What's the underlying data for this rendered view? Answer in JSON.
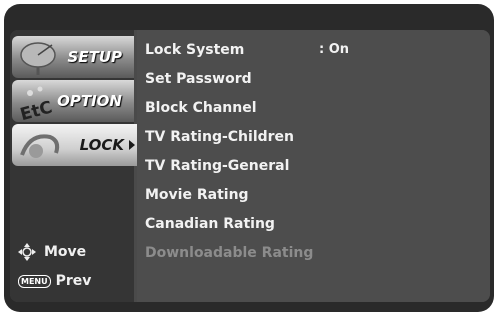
{
  "sidebar": {
    "tabs": [
      {
        "label": "SETUP",
        "icon": "satellite-dish-icon",
        "active": false
      },
      {
        "label": "OPTION",
        "icon": "etc-icon",
        "active": false
      },
      {
        "label": "LOCK",
        "icon": "lock-icon",
        "active": true
      }
    ],
    "legend": [
      {
        "icon": "navigation-pad-icon",
        "label": "Move"
      },
      {
        "icon": "menu-button-icon",
        "badge": "MENU",
        "label": "Prev"
      }
    ]
  },
  "menu": {
    "items": [
      {
        "label": "Lock System",
        "value": ": On",
        "enabled": true
      },
      {
        "label": "Set Password",
        "enabled": true
      },
      {
        "label": "Block Channel",
        "enabled": true
      },
      {
        "label": "TV Rating-Children",
        "enabled": true
      },
      {
        "label": "TV Rating-General",
        "enabled": true
      },
      {
        "label": "Movie Rating",
        "enabled": true
      },
      {
        "label": "Canadian Rating",
        "enabled": true
      },
      {
        "label": "Downloadable Rating",
        "enabled": false
      }
    ]
  },
  "colors": {
    "screen": "#4a4a4a",
    "text": "#f2f2f2",
    "disabled_text": "#8c8c8c"
  }
}
